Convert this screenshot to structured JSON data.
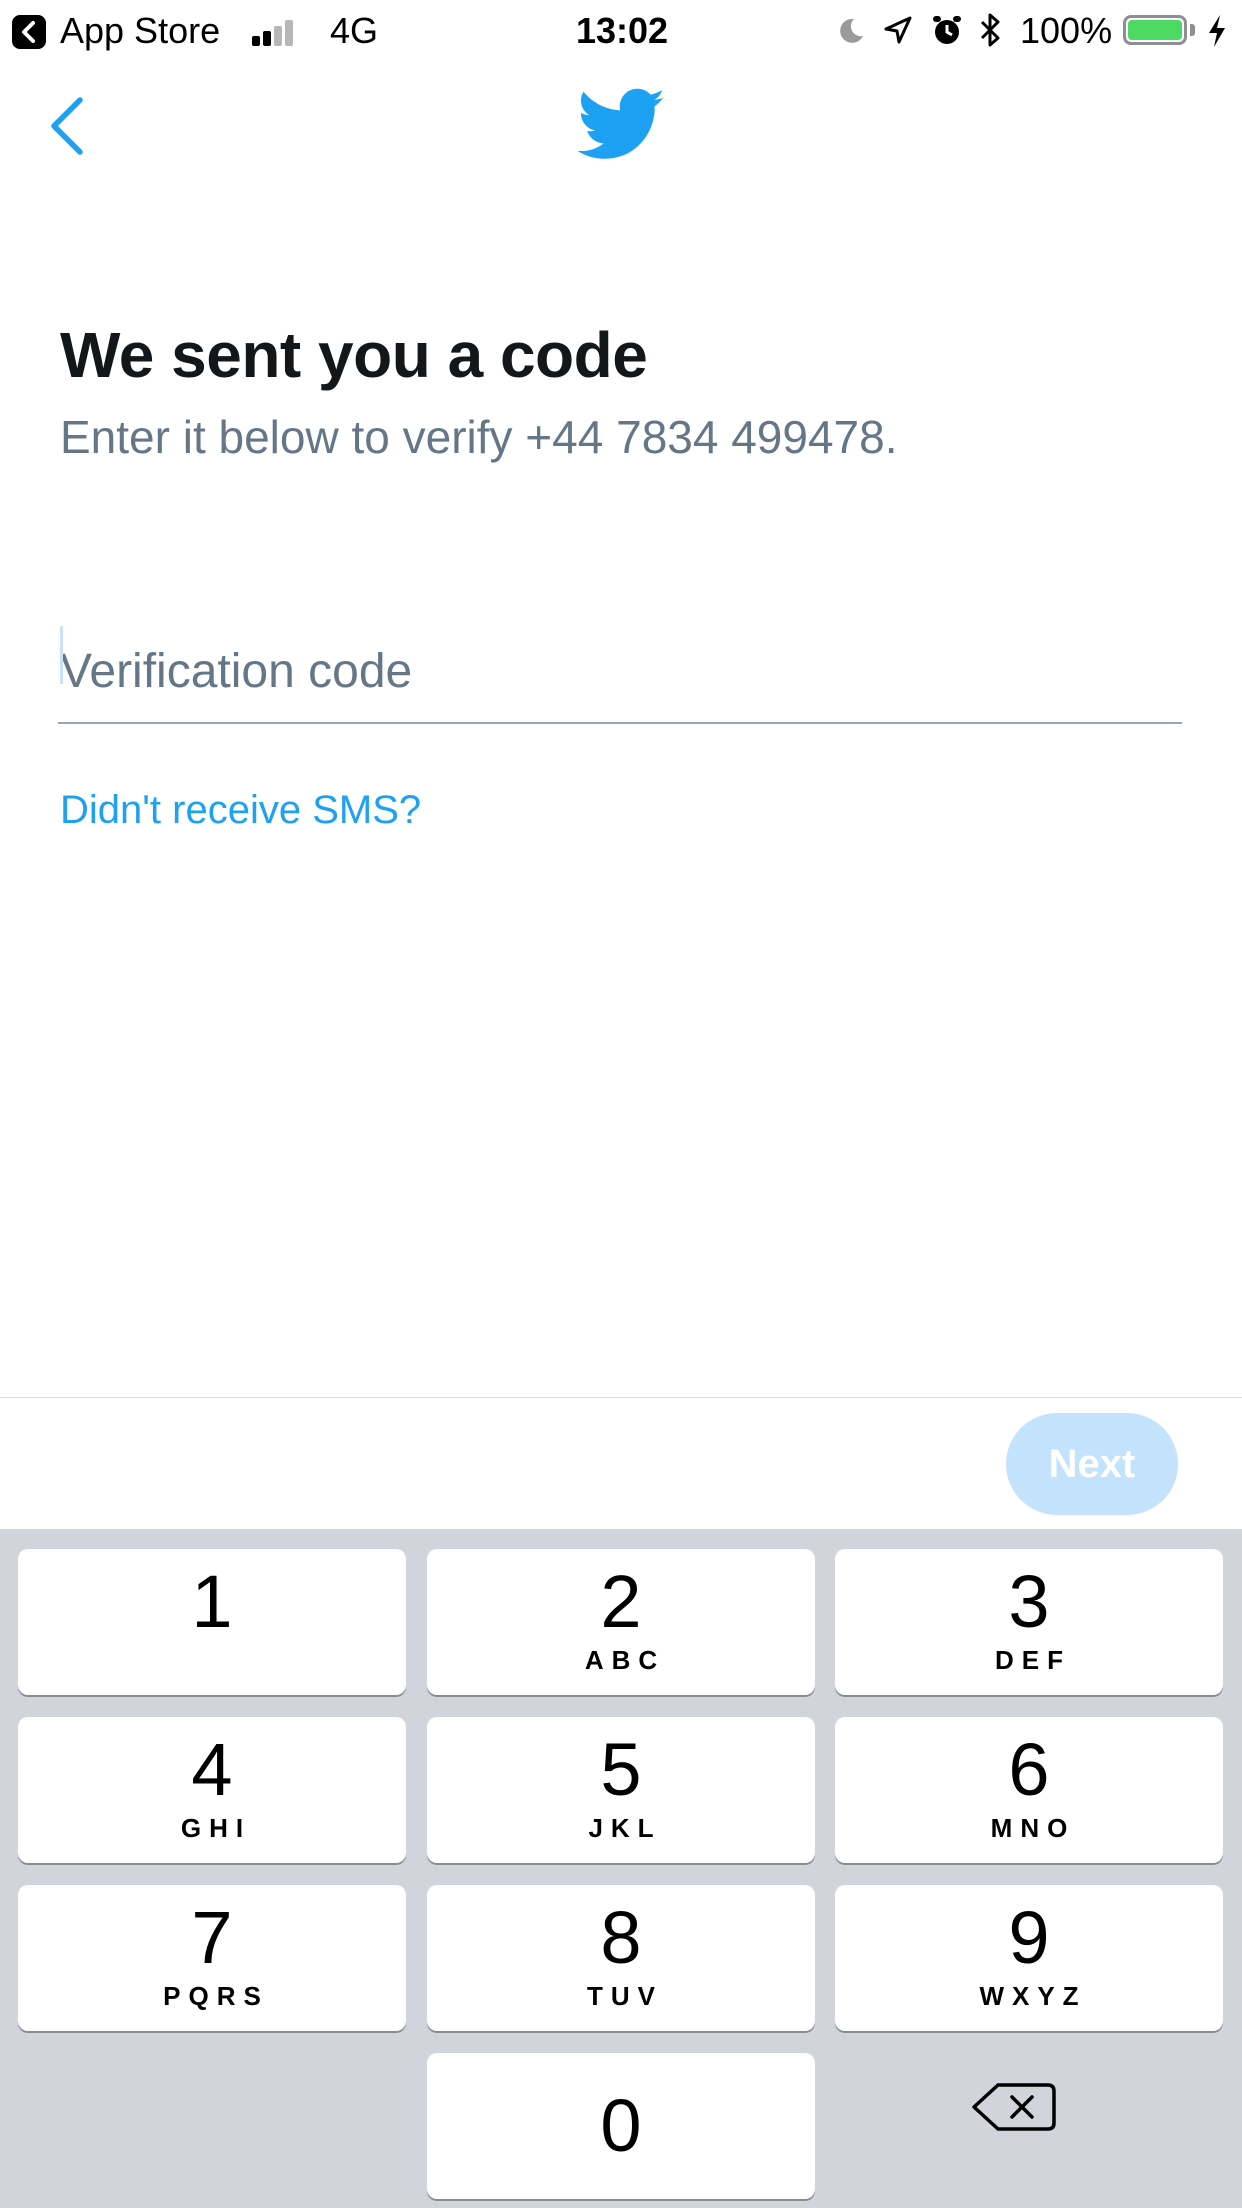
{
  "status_bar": {
    "back_app_label": "App Store",
    "network": "4G",
    "time": "13:02",
    "battery_percent": "100%",
    "battery_level": 1.0,
    "signal_bars": 2,
    "icons": [
      "back-arrow-icon",
      "signal-icon",
      "moon-icon",
      "location-icon",
      "alarm-icon",
      "bluetooth-icon",
      "battery-icon",
      "charging-icon"
    ]
  },
  "header": {
    "back_icon": "chevron-left-icon",
    "logo_icon": "twitter-bird-icon"
  },
  "colors": {
    "brand": "#1da1f2",
    "next_disabled_bg": "#c2e3fb",
    "subtitle": "#657786",
    "keypad_bg": "#d1d5db",
    "battery_green": "#4cd964"
  },
  "main": {
    "title": "We sent you a code",
    "subtitle": "Enter it below to verify +44 7834 499478.",
    "code_input": {
      "placeholder": "Verification code",
      "value": ""
    },
    "sms_link": "Didn't receive SMS?"
  },
  "footer": {
    "next_label": "Next"
  },
  "keypad": {
    "keys": [
      {
        "num": "1",
        "letters": ""
      },
      {
        "num": "2",
        "letters": "ABC"
      },
      {
        "num": "3",
        "letters": "DEF"
      },
      {
        "num": "4",
        "letters": "GHI"
      },
      {
        "num": "5",
        "letters": "JKL"
      },
      {
        "num": "6",
        "letters": "MNO"
      },
      {
        "num": "7",
        "letters": "PQRS"
      },
      {
        "num": "8",
        "letters": "TUV"
      },
      {
        "num": "9",
        "letters": "WXYZ"
      },
      {
        "num": "0",
        "letters": ""
      }
    ],
    "delete_icon": "backspace-icon"
  }
}
